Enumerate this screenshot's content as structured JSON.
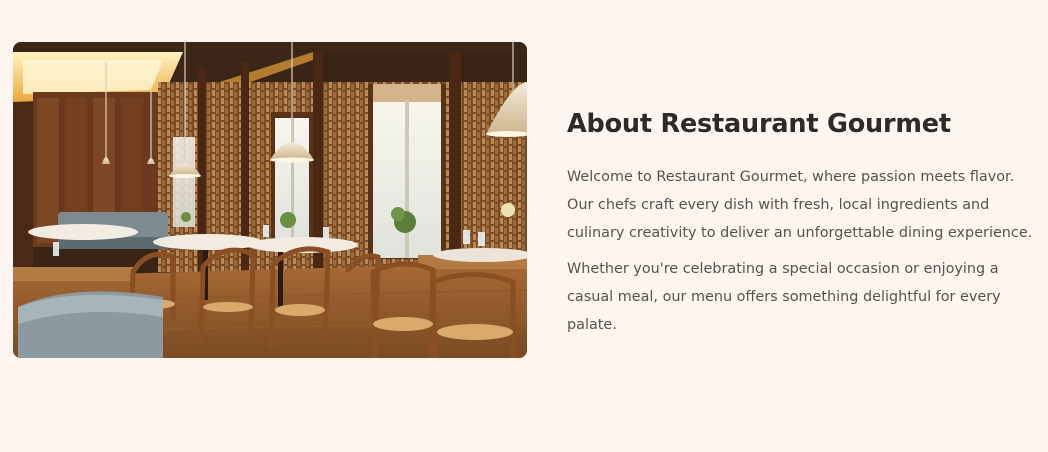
{
  "about": {
    "title": "About Restaurant Gourmet",
    "paragraph_1": "Welcome to Restaurant Gourmet, where passion meets flavor. Our chefs craft every dish with fresh, local ingredients and culinary creativity to deliver an unforgettable dining experience.",
    "paragraph_2": "Whether you're celebrating a special occasion or enjoying a casual meal, our menu offers something delightful for every palate."
  },
  "colors": {
    "page_background": "#fdf6f0",
    "title": "#2e2a27",
    "body_text": "#57524d"
  }
}
